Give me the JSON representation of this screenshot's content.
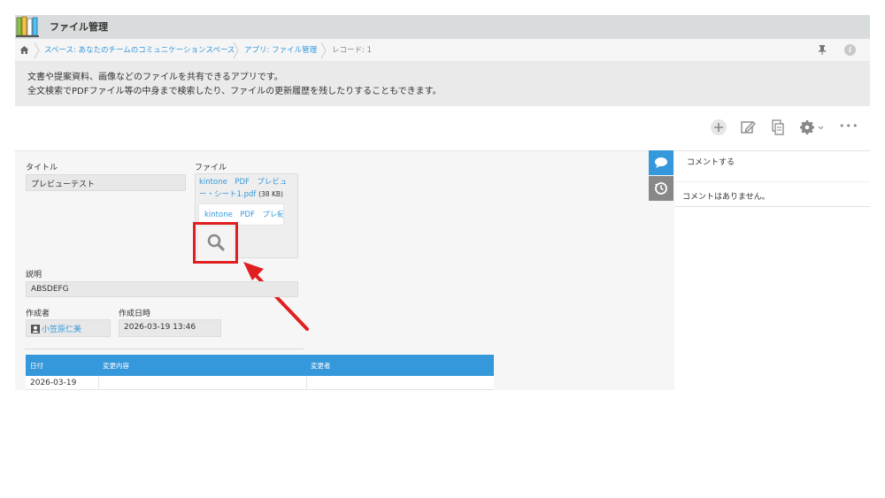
{
  "header": {
    "app_title": "ファイル管理"
  },
  "breadcrumb": {
    "space": "スペース: あなたのチームのコミュニケーションスペース",
    "app": "アプリ: ファイル管理",
    "record": "レコード: 1",
    "info_label": "i"
  },
  "description": {
    "line1": "文書や提案資料、画像などのファイルを共有できるアプリです。",
    "line2": "全文検索でPDFファイル等の中身まで検索したり、ファイルの更新履歴を残したりすることもできます。"
  },
  "toolbar": {
    "more_label": "•••"
  },
  "record": {
    "title_label": "タイトル",
    "title_value": "プレビューテスト",
    "file_label": "ファイル",
    "file_name": "kintone　PDF　プレビュー・シート1.pdf",
    "file_size": "(38 KB)",
    "preview_text": "kintone　PDF　プレ紀コ",
    "desc_label": "説明",
    "desc_value": "ABSDEFG",
    "creator_label": "作成者",
    "creator_value": "小笠原仁美",
    "created_label": "作成日時",
    "created_value": "2026-03-19 13:46"
  },
  "history": {
    "columns": [
      "日付",
      "変更内容",
      "変更者"
    ],
    "rows": [
      {
        "date": "2026-03-19",
        "change": "",
        "user": ""
      }
    ]
  },
  "side_panel": {
    "comment_action": "コメントする",
    "no_comments": "コメントはありません。"
  },
  "colors": {
    "accent": "#3498db",
    "highlight": "#e02020",
    "tab_active": "#3498db",
    "tab_inactive": "#888888"
  }
}
